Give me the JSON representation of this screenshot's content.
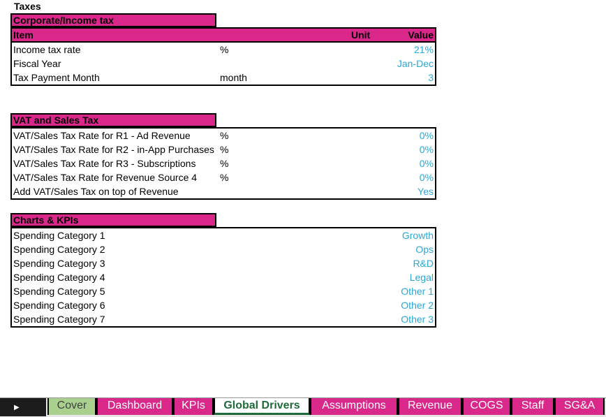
{
  "sheet": {
    "title": "Taxes"
  },
  "corporate": {
    "heading": "Corporate/Income tax",
    "columns": {
      "item": "Item",
      "unit": "Unit",
      "value": "Value"
    },
    "rows": [
      {
        "label": "Income tax rate",
        "unit": "%",
        "value": "21%"
      },
      {
        "label": "Fiscal Year",
        "unit": "",
        "value": "Jan-Dec"
      },
      {
        "label": "Tax Payment Month",
        "unit": "month",
        "value": "3"
      }
    ]
  },
  "vat": {
    "heading": "VAT and Sales Tax",
    "rows": [
      {
        "label": "VAT/Sales Tax Rate for R1 - Ad Revenue",
        "unit": "%",
        "value": "0%"
      },
      {
        "label": "VAT/Sales Tax Rate for R2 - in-App Purchases",
        "unit": "%",
        "value": "0%"
      },
      {
        "label": "VAT/Sales Tax Rate for R3 - Subscriptions",
        "unit": "%",
        "value": "0%"
      },
      {
        "label": "VAT/Sales Tax Rate for Revenue Source 4",
        "unit": "%",
        "value": "0%"
      },
      {
        "label": "Add VAT/Sales Tax on top of Revenue",
        "unit": "",
        "value": "Yes"
      }
    ]
  },
  "charts": {
    "heading": "Charts & KPIs",
    "rows": [
      {
        "label": "Spending Category 1",
        "value": "Growth"
      },
      {
        "label": "Spending Category 2",
        "value": "Ops"
      },
      {
        "label": "Spending Category 3",
        "value": "R&D"
      },
      {
        "label": "Spending Category 4",
        "value": "Legal"
      },
      {
        "label": "Spending Category 5",
        "value": "Other 1"
      },
      {
        "label": "Spending Category 6",
        "value": "Other 2"
      },
      {
        "label": "Spending Category 7",
        "value": "Other 3"
      }
    ]
  },
  "tabs": {
    "nav_icon": "play-right-icon",
    "items": [
      "Cover",
      "Dashboard",
      "KPIs",
      "Global Drivers",
      "Assumptions",
      "Revenue",
      "COGS",
      "Staff",
      "SG&A"
    ],
    "active": "Global Drivers"
  },
  "colors": {
    "header_fill": "#d9288a",
    "value_text": "#29a8d8",
    "cover_tab": "#a9d08e",
    "active_tab_text": "#1f6b3a"
  }
}
